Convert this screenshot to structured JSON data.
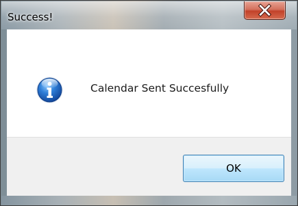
{
  "window": {
    "title": "Success!"
  },
  "titlebar": {
    "close_icon": "close-icon"
  },
  "dialog": {
    "icon": "info-icon",
    "message": "Calendar Sent Succesfully"
  },
  "buttons": {
    "ok_label": "OK"
  },
  "colors": {
    "content_bg": "#ffffff",
    "footer_bg": "#f0f0f0",
    "close_button": "#c2422a",
    "info_icon": "#1f5fb8"
  }
}
